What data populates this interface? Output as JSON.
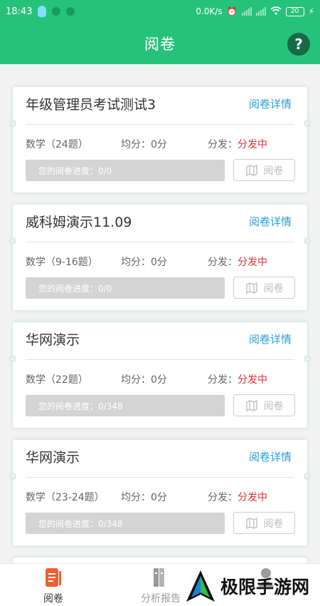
{
  "status_bar": {
    "time": "18:43",
    "network_speed": "0.0K/s",
    "battery_level": "20"
  },
  "header": {
    "title": "阅卷",
    "help_label": "?"
  },
  "cards": [
    {
      "name": "年级管理员考试测试3",
      "detail_label": "阅卷详情",
      "subject": "数学（24题）",
      "average": "均分：0分",
      "distribution_label": "分发：",
      "distribution_status": "分发中",
      "progress": "您的阅卷进度：0/0",
      "review_label": "阅卷"
    },
    {
      "name": "威科姆演示11.09",
      "detail_label": "阅卷详情",
      "subject": "数学（9-16题）",
      "average": "均分：0分",
      "distribution_label": "分发：",
      "distribution_status": "分发中",
      "progress": "您的阅卷进度：0/0",
      "review_label": "阅卷"
    },
    {
      "name": "华网演示",
      "detail_label": "阅卷详情",
      "subject": "数学（22题）",
      "average": "均分：0分",
      "distribution_label": "分发：",
      "distribution_status": "分发中",
      "progress": "您的阅卷进度：0/348",
      "review_label": "阅卷"
    },
    {
      "name": "华网演示",
      "detail_label": "阅卷详情",
      "subject": "数学（23-24题）",
      "average": "均分：0分",
      "distribution_label": "分发：",
      "distribution_status": "分发中",
      "progress": "您的阅卷进度：0/348",
      "review_label": "阅卷"
    }
  ],
  "tabbar": {
    "review": "阅卷",
    "report": "分析报告",
    "mine": ""
  },
  "watermark": {
    "text": "极限手游网"
  },
  "colors": {
    "primary": "#27c27a",
    "accent_link": "#2b9fd4",
    "status_red": "#e0303a",
    "tab_active_icon": "#f06033"
  },
  "icons": {
    "help": "question-icon",
    "review_tab": "exam-paper-icon",
    "report_tab": "books-icon",
    "review_button": "map-icon"
  }
}
